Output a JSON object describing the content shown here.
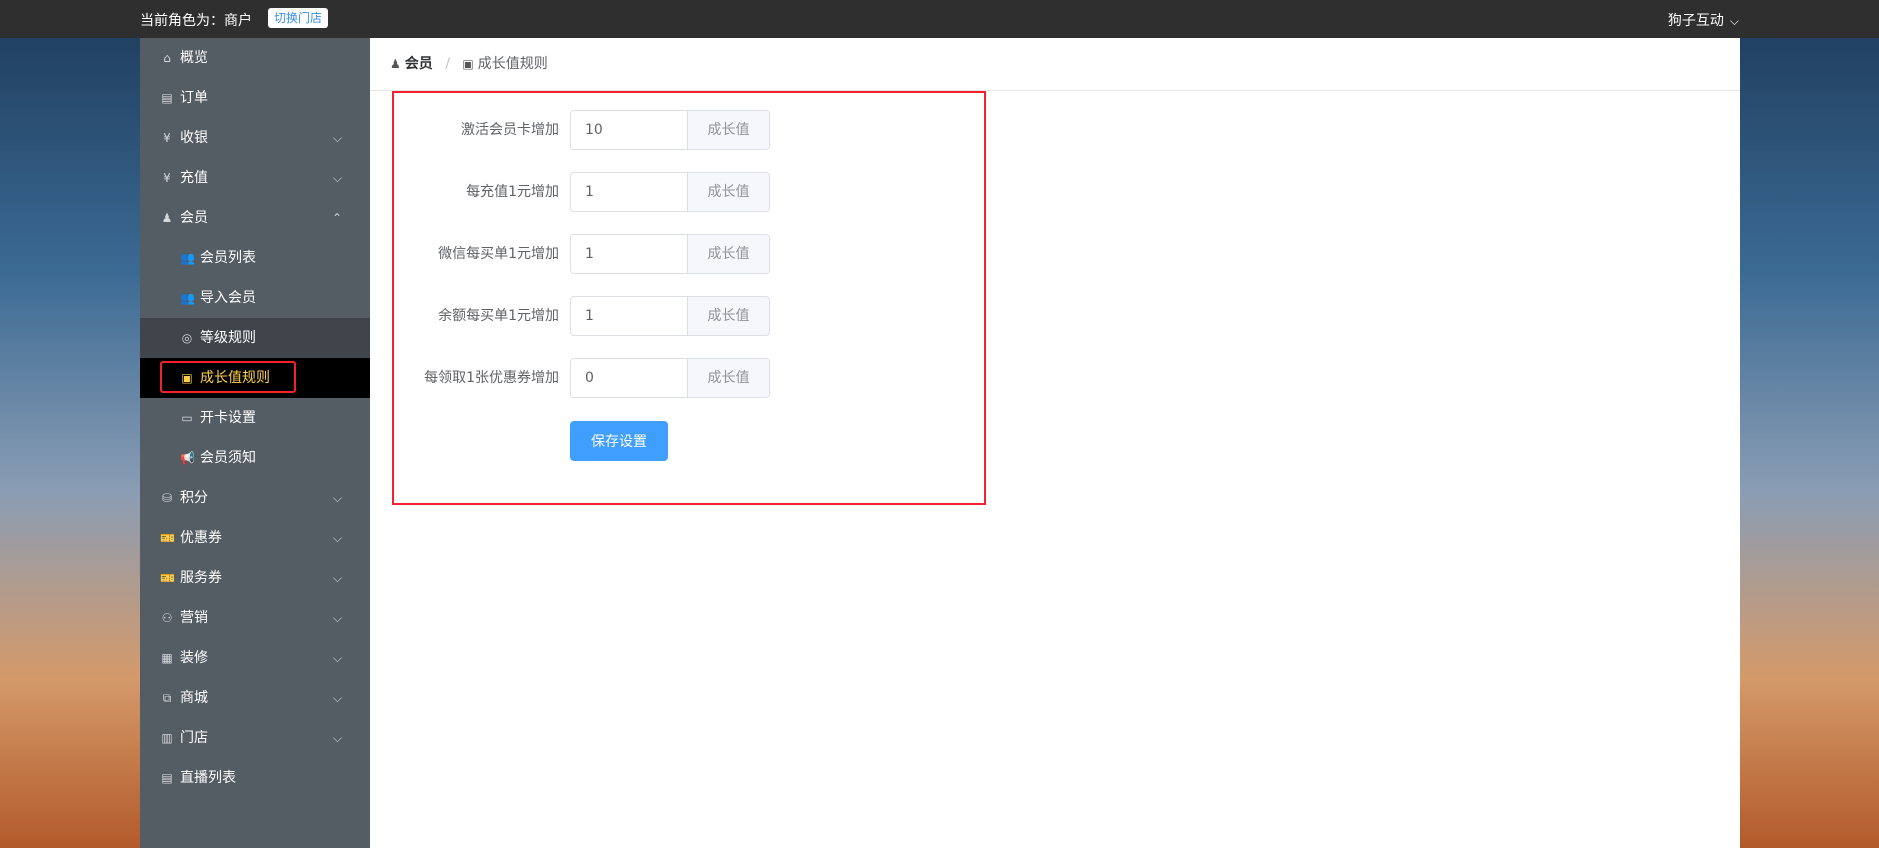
{
  "topbar": {
    "role_text": "当前角色为：商户",
    "switch_store": "切换门店",
    "user_name": "狗子互动"
  },
  "sidebar": {
    "items": [
      {
        "label": "概览",
        "icon": "home-icon"
      },
      {
        "label": "订单",
        "icon": "document-icon"
      },
      {
        "label": "收银",
        "icon": "cashier-icon"
      },
      {
        "label": "充值",
        "icon": "recharge-icon"
      },
      {
        "label": "会员",
        "icon": "member-icon"
      },
      {
        "label": "积分",
        "icon": "points-icon"
      },
      {
        "label": "优惠券",
        "icon": "coupon-icon"
      },
      {
        "label": "服务券",
        "icon": "service-ticket-icon"
      },
      {
        "label": "营销",
        "icon": "marketing-icon"
      },
      {
        "label": "装修",
        "icon": "decoration-icon"
      },
      {
        "label": "商城",
        "icon": "mall-icon"
      },
      {
        "label": "门店",
        "icon": "store-icon"
      },
      {
        "label": "直播列表",
        "icon": "live-list-icon"
      }
    ],
    "member_sub": [
      {
        "label": "会员列表",
        "icon": "users-icon"
      },
      {
        "label": "导入会员",
        "icon": "import-users-icon"
      },
      {
        "label": "等级规则",
        "icon": "badge-icon"
      },
      {
        "label": "成长值规则",
        "icon": "growth-icon"
      },
      {
        "label": "开卡设置",
        "icon": "card-icon"
      },
      {
        "label": "会员须知",
        "icon": "notice-icon"
      }
    ]
  },
  "breadcrumb": {
    "parent": "会员",
    "separator": "/",
    "current": "成长值规则"
  },
  "form": {
    "unit": "成长值",
    "rows": [
      {
        "label": "激活会员卡增加",
        "value": "10"
      },
      {
        "label": "每充值1元增加",
        "value": "1"
      },
      {
        "label": "微信每买单1元增加",
        "value": "1"
      },
      {
        "label": "余额每买单1元增加",
        "value": "1"
      },
      {
        "label": "每领取1张优惠券增加",
        "value": "0"
      }
    ],
    "save_label": "保存设置"
  },
  "colors": {
    "topbar": "#2f2f2f",
    "sidebar": "#545c64",
    "active_text": "#ffd04b",
    "primary": "#409eff",
    "highlight_border": "#f5222d"
  }
}
